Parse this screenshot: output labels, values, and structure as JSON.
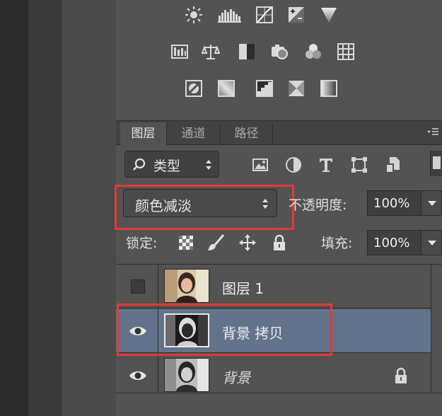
{
  "tabs": [
    {
      "label": "图层",
      "active": true
    },
    {
      "label": "通道",
      "active": false
    },
    {
      "label": "路径",
      "active": false
    }
  ],
  "filter": {
    "label": "类型"
  },
  "blend_mode": {
    "value": "颜色减淡"
  },
  "opacity": {
    "label": "不透明度:",
    "value": "100%"
  },
  "lock": {
    "label": "锁定:"
  },
  "fill": {
    "label": "填充:",
    "value": "100%"
  },
  "layers": [
    {
      "name": "图层 1",
      "visible": false,
      "selected": false,
      "locked": false
    },
    {
      "name": "背景 拷贝",
      "visible": true,
      "selected": true,
      "locked": false
    },
    {
      "name": "背景",
      "visible": true,
      "selected": false,
      "locked": true
    }
  ],
  "colors": {
    "panel": "#535353",
    "selected_row": "#63738c",
    "highlight": "#e53935"
  },
  "icons": {
    "adjustments_row1": [
      "brightness-contrast-icon",
      "levels-icon",
      "curves-icon",
      "exposure-icon",
      "gradient-triangle-icon"
    ],
    "adjustments_row2": [
      "vibrance-icon",
      "color-balance-icon",
      "black-white-icon",
      "photo-filter-icon",
      "channel-mixer-icon",
      "color-lookup-icon"
    ],
    "adjustments_row3": [
      "invert-icon",
      "posterize-icon",
      "threshold-icon",
      "selective-color-icon",
      "gradient-map-icon"
    ],
    "filter_kinds": [
      "pixel-filter-icon",
      "adjustment-filter-icon",
      "type-filter-icon",
      "shape-filter-icon",
      "smart-object-filter-icon"
    ],
    "lock_kinds": [
      "lock-transparent-icon",
      "lock-image-icon",
      "lock-position-icon",
      "lock-all-icon"
    ]
  }
}
